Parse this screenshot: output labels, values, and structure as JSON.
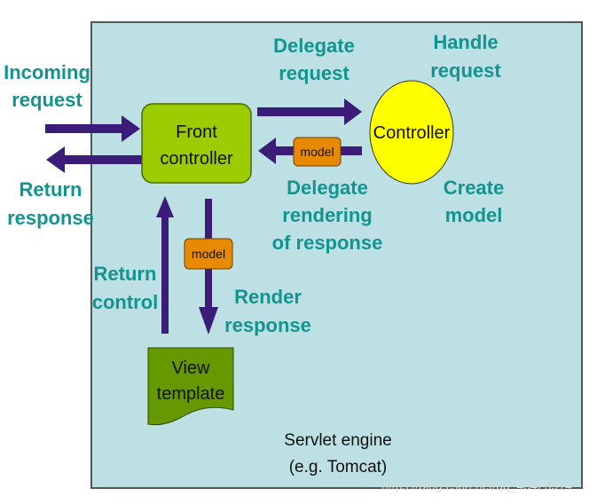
{
  "colors": {
    "container_fill": "#bce0e3",
    "container_border": "#555555",
    "arrow": "#3b1c78",
    "label": "#13948f",
    "front_controller_fill": "#9acc00",
    "controller_fill": "#ffff00",
    "model_badge_fill": "#e88a00",
    "view_template_fill": "#669900"
  },
  "container": {
    "label_line1": "Servlet engine",
    "label_line2": "(e.g. Tomcat)"
  },
  "nodes": {
    "front_controller": {
      "line1": "Front",
      "line2": "controller"
    },
    "controller": {
      "label": "Controller"
    },
    "view_template": {
      "line1": "View",
      "line2": "template"
    },
    "model_badge_top": {
      "label": "model"
    },
    "model_badge_bottom": {
      "label": "model"
    }
  },
  "labels": {
    "incoming_request": [
      "Incoming",
      "request"
    ],
    "return_response": [
      "Return",
      "response"
    ],
    "delegate_request": [
      "Delegate",
      "request"
    ],
    "handle_request": [
      "Handle",
      "request"
    ],
    "delegate_rendering": [
      "Delegate",
      "rendering",
      "of response"
    ],
    "create_model": [
      "Create",
      "model"
    ],
    "return_control": [
      "Return",
      "control"
    ],
    "render_response": [
      "Render",
      "response"
    ]
  },
  "edges": [
    {
      "from": "client",
      "to": "front_controller",
      "label": "Incoming request"
    },
    {
      "from": "front_controller",
      "to": "client",
      "label": "Return response"
    },
    {
      "from": "front_controller",
      "to": "controller",
      "label": "Delegate request"
    },
    {
      "from": "controller",
      "to": "front_controller",
      "label": "Delegate rendering of response",
      "carries": "model"
    },
    {
      "from": "front_controller",
      "to": "view_template",
      "label": "Render response",
      "carries": "model"
    },
    {
      "from": "view_template",
      "to": "front_controller",
      "label": "Return control"
    }
  ],
  "watermark": "https://blog.csdn.net/qq_43425914"
}
